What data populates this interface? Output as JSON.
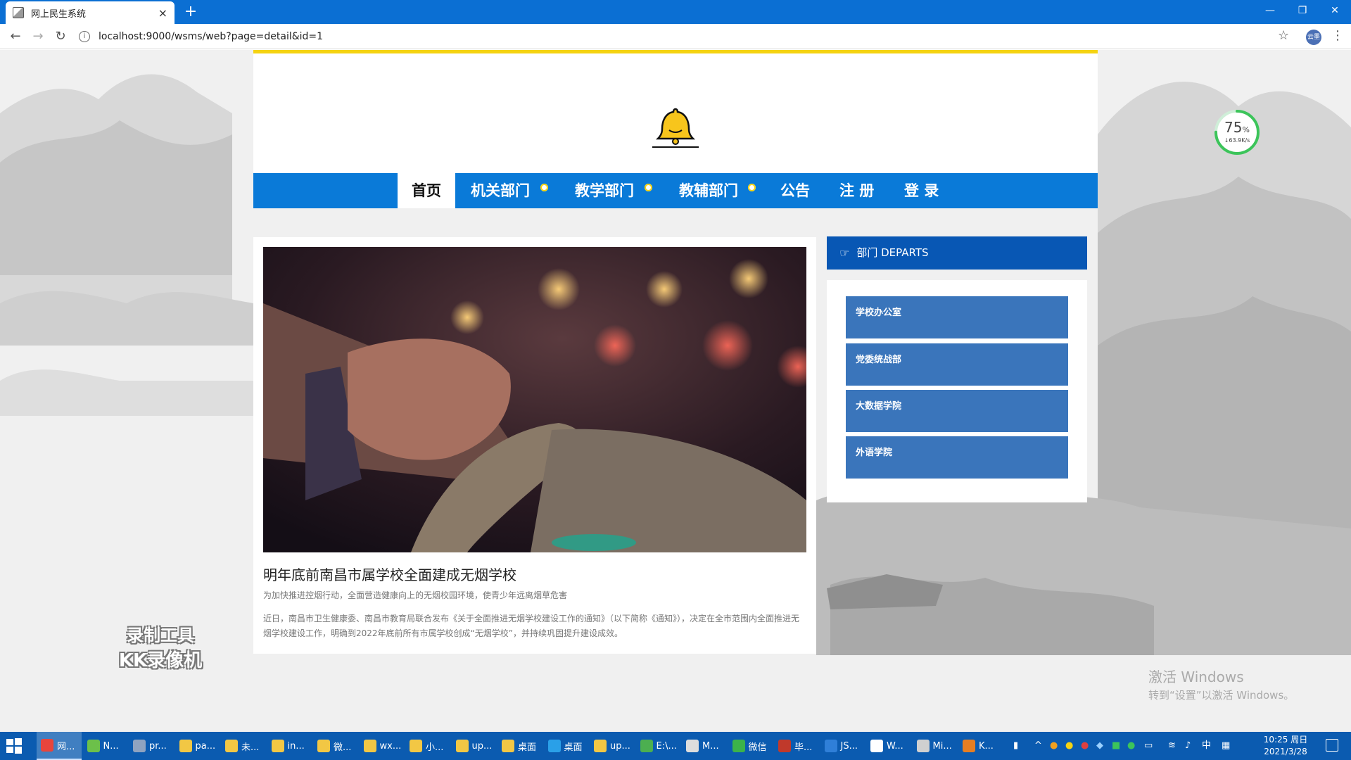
{
  "browser": {
    "tab_title": "网上民生系统",
    "tab_close": "×",
    "new_tab": "+",
    "url": "localhost:9000/wsms/web?page=detail&id=1",
    "profile_label": "云墨",
    "window_controls": {
      "minimize": "—",
      "restore": "❐",
      "close": "✕"
    }
  },
  "nav": {
    "items": [
      {
        "label": "首页",
        "active": true,
        "has_dot": false
      },
      {
        "label": "机关部门",
        "active": false,
        "has_dot": true
      },
      {
        "label": "教学部门",
        "active": false,
        "has_dot": true
      },
      {
        "label": "教辅部门",
        "active": false,
        "has_dot": true
      },
      {
        "label": "公告",
        "active": false,
        "has_dot": false
      },
      {
        "label": "注 册",
        "active": false,
        "has_dot": false
      },
      {
        "label": "登 录",
        "active": false,
        "has_dot": false
      }
    ]
  },
  "article": {
    "title": "明年底前南昌市属学校全面建成无烟学校",
    "summary": "为加快推进控烟行动，全面营造健康向上的无烟校园环境，使青少年远离烟草危害",
    "body": "近日，南昌市卫生健康委、南昌市教育局联合发布《关于全面推进无烟学校建设工作的通知》（以下简称《通知》），决定在全市范围内全面推进无烟学校建设工作，明确到2022年底前所有市属学校创成“无烟学校”，并持续巩固提升建设成效。"
  },
  "sidebar": {
    "header": "部门 DEPARTS",
    "header_icon": "☞",
    "departments": [
      "学校办公室",
      "党委统战部",
      "大数据学院",
      "外语学院"
    ]
  },
  "speed_widget": {
    "percent": "75",
    "percent_unit": "%",
    "rate": "↓63.9K/s"
  },
  "watermark": {
    "line1": "录制工具",
    "line2": "KK录像机"
  },
  "activation": {
    "line1": "激活 Windows",
    "line2": "转到“设置”以激活 Windows。"
  },
  "taskbar": {
    "items": [
      {
        "label": "网...",
        "color": "#e8453c",
        "active": true
      },
      {
        "label": "N...",
        "color": "#6cc04a",
        "active": false
      },
      {
        "label": "pr...",
        "color": "#8fa3c0",
        "active": false
      },
      {
        "label": "pa...",
        "color": "#f2c744",
        "active": false
      },
      {
        "label": "未...",
        "color": "#f2c744",
        "active": false
      },
      {
        "label": "in...",
        "color": "#f2c744",
        "active": false
      },
      {
        "label": "微...",
        "color": "#f2c744",
        "active": false
      },
      {
        "label": "wx...",
        "color": "#f2c744",
        "active": false
      },
      {
        "label": "小...",
        "color": "#f2c744",
        "active": false
      },
      {
        "label": "up...",
        "color": "#f2c744",
        "active": false
      },
      {
        "label": "桌面",
        "color": "#f2c744",
        "active": false
      },
      {
        "label": "桌面",
        "color": "#2aa0e8",
        "active": false
      },
      {
        "label": "up...",
        "color": "#f2c744",
        "active": false
      },
      {
        "label": "E:\\...",
        "color": "#4caf50",
        "active": false
      },
      {
        "label": "M...",
        "color": "#dddddd",
        "active": false
      },
      {
        "label": "微信",
        "color": "#3cb34a",
        "active": false
      },
      {
        "label": "毕...",
        "color": "#c0392b",
        "active": false
      },
      {
        "label": "JS...",
        "color": "#2f7fd8",
        "active": false
      },
      {
        "label": "W...",
        "color": "#ffffff",
        "active": false
      },
      {
        "label": "Mi...",
        "color": "#d0d0d0",
        "active": false
      },
      {
        "label": "K...",
        "color": "#e67e22",
        "active": false
      }
    ],
    "ime": "中",
    "time": "10:25 周日",
    "date": "2021/3/28"
  }
}
